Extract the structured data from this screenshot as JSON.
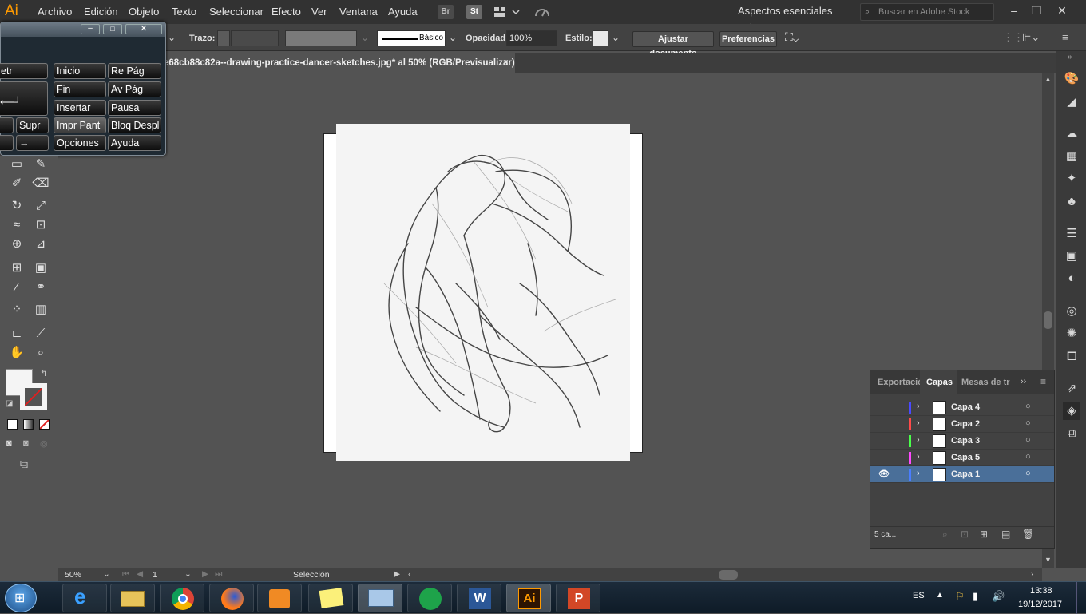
{
  "menubar": {
    "logo": "Ai",
    "items": [
      "Archivo",
      "Edición",
      "Objeto",
      "Texto",
      "Seleccionar",
      "Efecto",
      "Ver",
      "Ventana",
      "Ayuda"
    ],
    "bridge_label": "Br",
    "stock_label": "St",
    "workspace": "Aspectos esenciales",
    "search_placeholder": "Buscar en Adobe Stock"
  },
  "control_bar": {
    "stroke_label": "Trazo:",
    "stroke_profile": "Básico",
    "opacity_label": "Opacidad:",
    "opacity_value": "100%",
    "style_label": "Estilo:",
    "fit_document": "Ajustar documento",
    "preferences": "Preferencias"
  },
  "document_tab": {
    "title": "e68cb88c82a--drawing-practice-dancer-sketches.jpg* al 50% (RGB/Previsualizar)",
    "close": "×"
  },
  "onscreen_keyboard": {
    "rows": [
      [
        "etr",
        "Inicio",
        "Re Pág"
      ],
      [
        "",
        "Fin",
        "Av Pág"
      ],
      [
        "",
        "Insertar",
        "Pausa"
      ],
      [
        "",
        "Supr",
        "Impr Pant",
        "Bloq Despl"
      ],
      [
        "",
        "→",
        "Opciones",
        "Ayuda"
      ]
    ]
  },
  "layers_panel": {
    "tabs": [
      "Exportació",
      "Capas",
      "Mesas de tr"
    ],
    "layers": [
      {
        "name": "Capa 4",
        "color": "#4a4aff",
        "visible": false
      },
      {
        "name": "Capa 2",
        "color": "#ff4a4a",
        "visible": false
      },
      {
        "name": "Capa 3",
        "color": "#4aff4a",
        "visible": false
      },
      {
        "name": "Capa 5",
        "color": "#ff4aff",
        "visible": false
      },
      {
        "name": "Capa 1",
        "color": "#4a7dff",
        "visible": true
      }
    ],
    "count": "5 ca..."
  },
  "status_bar": {
    "zoom": "50%",
    "artboard_number": "1",
    "tool_status": "Selección"
  },
  "taskbar": {
    "language": "ES",
    "time": "13:38",
    "date": "19/12/2017"
  }
}
